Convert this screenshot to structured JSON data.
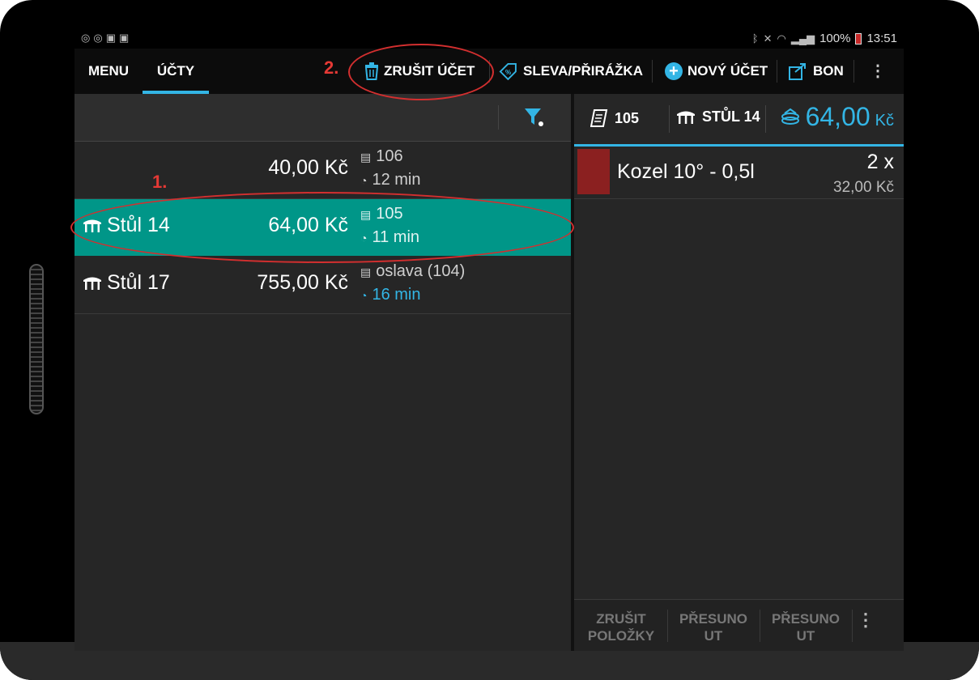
{
  "status_bar": {
    "left_icons": [
      "notification-icon",
      "notification-icon",
      "briefcase-icon",
      "briefcase-icon"
    ],
    "battery": "100%",
    "time": "13:51"
  },
  "action_bar": {
    "tabs": [
      {
        "label": "MENU",
        "active": false
      },
      {
        "label": "ÚČTY",
        "active": true
      }
    ],
    "cancel_account": "ZRUŠIT ÚČET",
    "discount": "SLEVA/PŘIRÁŽKA",
    "new_account": "NOVÝ ÚČET",
    "bon": "BON",
    "overflow": "⋮"
  },
  "accounts": [
    {
      "name": "",
      "amount": "40,00 Kč",
      "ref": "106",
      "time": "12 min",
      "selected": false,
      "time_highlight": false
    },
    {
      "name": "Stůl 14",
      "amount": "64,00 Kč",
      "ref": "105",
      "time": "11 min",
      "selected": true,
      "time_highlight": false
    },
    {
      "name": "Stůl 17",
      "amount": "755,00 Kč",
      "ref": "oslava (104)",
      "time": "16 min",
      "selected": false,
      "time_highlight": true
    }
  ],
  "detail": {
    "receipt_no": "105",
    "table": "STŮL 14",
    "total": "64,00",
    "currency": "Kč",
    "items": [
      {
        "name": "Kozel 10° - 0,5l",
        "qty": "2 x",
        "price": "32,00 Kč",
        "color": "#8b2020"
      }
    ]
  },
  "bottom_bar": {
    "cancel_items_l1": "ZRUŠIT",
    "cancel_items_l2": "POLOŽKY",
    "move1_l1": "PŘESUNO",
    "move1_l2": "UT",
    "move2_l1": "PŘESUNO",
    "move2_l2": "UT",
    "overflow": "⋮"
  },
  "annotations": {
    "step1": "1.",
    "step2": "2."
  },
  "colors": {
    "accent": "#33b5e5",
    "selected_row": "#009688",
    "annotation": "#d32f2f"
  }
}
